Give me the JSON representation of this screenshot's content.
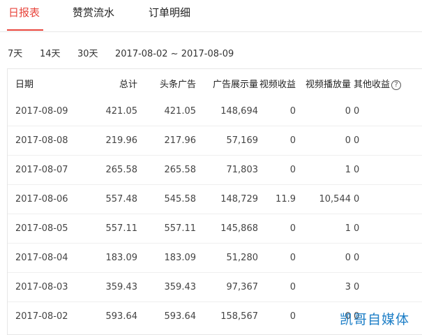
{
  "tabs": [
    {
      "label": "日报表"
    },
    {
      "label": "赞赏流水"
    },
    {
      "label": "订单明细"
    }
  ],
  "ranges": {
    "r7": "7天",
    "r14": "14天",
    "r30": "30天",
    "date_range": "2017-08-02  ~  2017-08-09"
  },
  "table": {
    "headers": [
      "日期",
      "总计",
      "头条广告",
      "广告展示量",
      "视频收益",
      "视频播放量",
      "其他收益"
    ],
    "rows": [
      [
        "2017-08-09",
        "421.05",
        "421.05",
        "148,694",
        "0",
        "0",
        "0"
      ],
      [
        "2017-08-08",
        "219.96",
        "217.96",
        "57,169",
        "0",
        "0",
        "0"
      ],
      [
        "2017-08-07",
        "265.58",
        "265.58",
        "71,803",
        "0",
        "1",
        "0"
      ],
      [
        "2017-08-06",
        "557.48",
        "545.58",
        "148,729",
        "11.9",
        "10,544",
        "0"
      ],
      [
        "2017-08-05",
        "557.11",
        "557.11",
        "145,868",
        "0",
        "1",
        "0"
      ],
      [
        "2017-08-04",
        "183.09",
        "183.09",
        "51,280",
        "0",
        "0",
        "0"
      ],
      [
        "2017-08-03",
        "359.43",
        "359.43",
        "97,367",
        "0",
        "3",
        "0"
      ],
      [
        "2017-08-02",
        "593.64",
        "593.64",
        "158,567",
        "0",
        "0",
        "0"
      ]
    ]
  },
  "watermark": "凯哥自媒体",
  "colors": {
    "accent": "#e8453c",
    "watermark": "#1e7fc7"
  }
}
